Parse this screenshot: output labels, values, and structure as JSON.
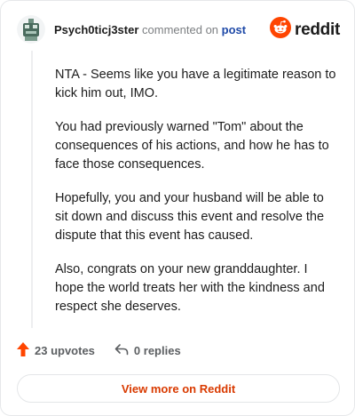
{
  "header": {
    "username": "Psych0ticj3ster",
    "commented_on": "commented on",
    "post_link": "post",
    "brand": "reddit"
  },
  "comment": {
    "paragraphs": [
      "NTA - Seems like you have a legitimate reason to kick him out, IMO.",
      "You had previously warned \"Tom\" about the consequences of his actions, and how he has to face those consequences.",
      "Hopefully, you and your husband will be able to sit down and discuss this event and resolve the dispute that this event has caused.",
      "Also, congrats on your new granddaughter. I hope the world treats her with the kindness and respect she deserves."
    ]
  },
  "actions": {
    "upvotes": "23 upvotes",
    "replies": "0 replies"
  },
  "footer": {
    "view_more": "View more on Reddit"
  },
  "colors": {
    "upvote": "#ff4500",
    "brand": "#ff4500",
    "link": "#1f4aa8",
    "view_more": "#d93a00"
  },
  "icons": [
    "avatar-icon",
    "reddit-logo-icon",
    "upvote-arrow-icon",
    "reply-arrow-icon"
  ]
}
